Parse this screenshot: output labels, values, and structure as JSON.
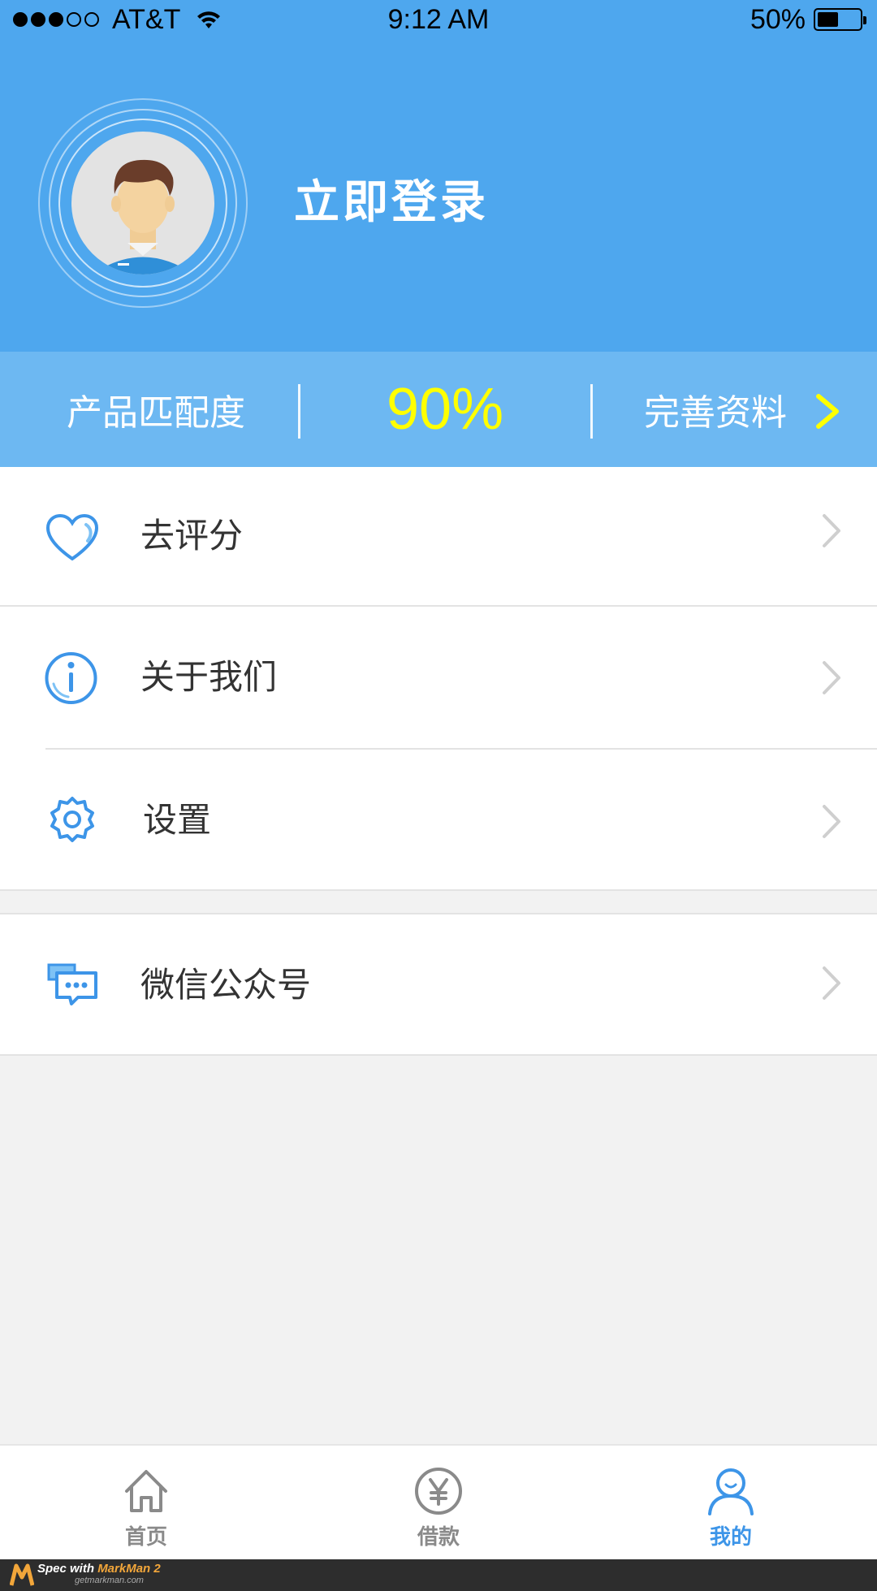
{
  "status_bar": {
    "carrier": "AT&T",
    "time": "9:12 AM",
    "battery_text": "50%",
    "battery_level": 0.5
  },
  "header": {
    "login_text": "立即登录",
    "avatar_icon": "user-avatar-icon"
  },
  "match_bar": {
    "label": "产品匹配度",
    "value": "90%",
    "complete_label": "完善资料",
    "arrow_icon": "chevron-right-icon",
    "value_color": "#ffff00"
  },
  "menu": {
    "rate": {
      "label": "去评分",
      "icon": "heart-icon"
    },
    "about": {
      "label": "关于我们",
      "icon": "info-icon"
    },
    "settings": {
      "label": "设置",
      "icon": "gear-icon"
    },
    "wechat": {
      "label": "微信公众号",
      "icon": "chat-bubbles-icon"
    }
  },
  "tabbar": {
    "tabs": [
      {
        "label": "首页",
        "icon": "home-icon",
        "active": false
      },
      {
        "label": "借款",
        "icon": "yen-icon",
        "active": false
      },
      {
        "label": "我的",
        "icon": "user-icon",
        "active": true
      }
    ]
  },
  "footer": {
    "spec_text": "Spec with ",
    "brand": "MarkMan 2",
    "site": "getmarkman.com"
  },
  "colors": {
    "header_bg": "#4ea7ee",
    "match_bg": "#6db8f2",
    "accent_blue": "#3d95e8",
    "text": "#333333"
  }
}
